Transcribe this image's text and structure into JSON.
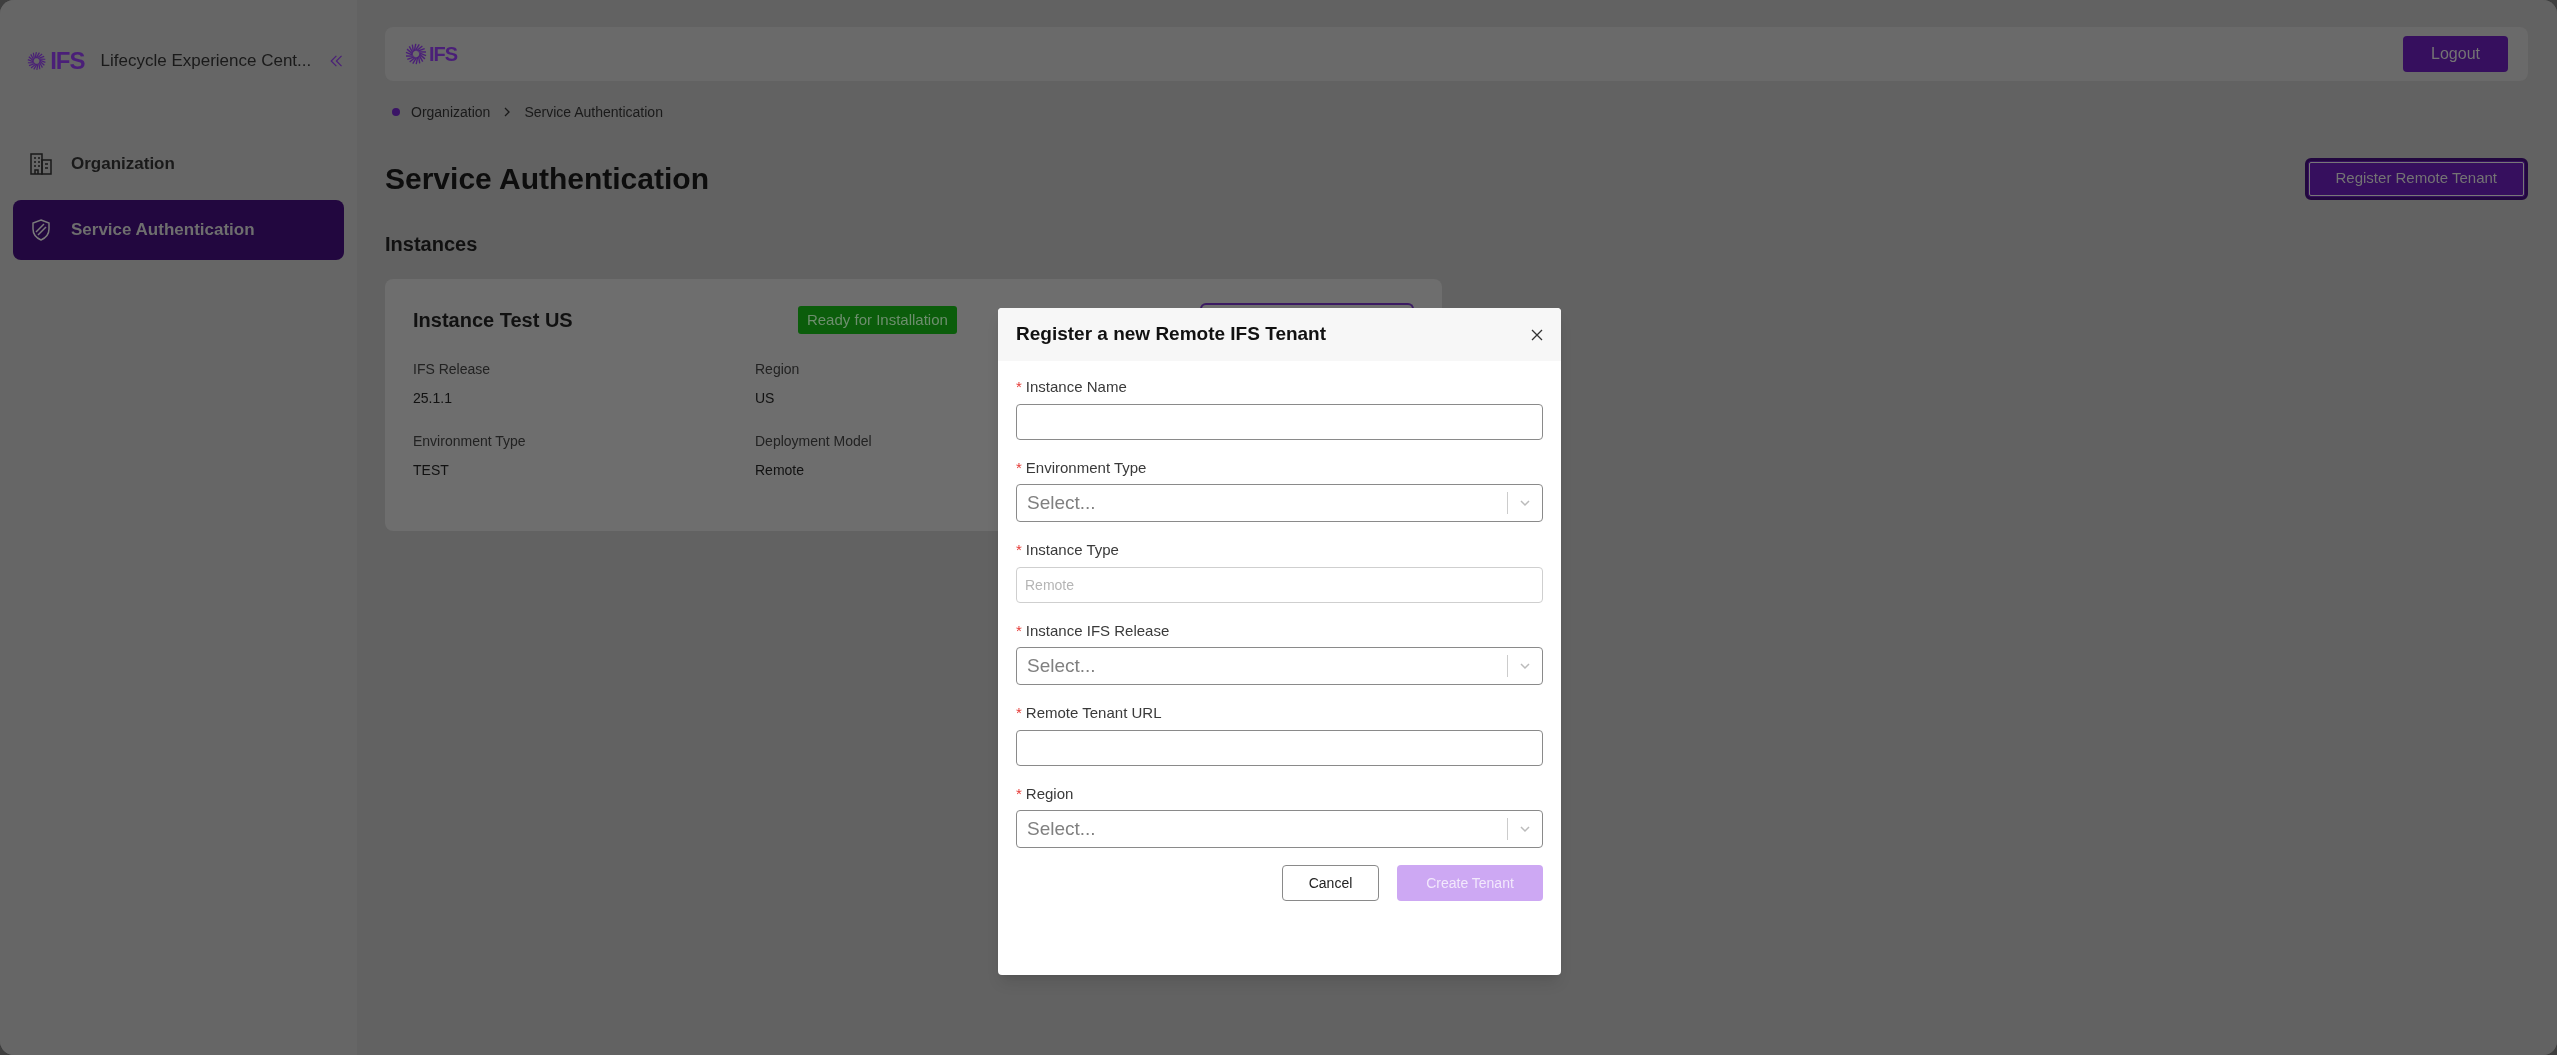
{
  "sidebar": {
    "logo_text": "IFS",
    "app_title": "Lifecycle Experience Cent...",
    "items": [
      {
        "kind": "building",
        "label": "Organization",
        "selected": false
      },
      {
        "kind": "shield",
        "label": "Service Authentication",
        "selected": true
      }
    ]
  },
  "top_bar": {
    "logo_text": "IFS",
    "logout": "Logout"
  },
  "breadcrumb": [
    "Organization",
    "Service Authentication"
  ],
  "page_title": "Service Authentication",
  "register_button": "Register Remote Tenant",
  "section_title": "Instances",
  "instance_card": {
    "name": "Instance Test US",
    "status": "Ready for Installation",
    "fields": [
      {
        "label": "IFS Release",
        "value": "25.1.1"
      },
      {
        "label": "Region",
        "value": "US"
      },
      {
        "label": "Environment Type",
        "value": "TEST"
      },
      {
        "label": "Deployment Model",
        "value": "Remote"
      }
    ]
  },
  "dialog": {
    "title": "Register a new Remote IFS Tenant",
    "fields": [
      {
        "kind": "text",
        "marker": "*",
        "label": "Instance Name",
        "disabled": false
      },
      {
        "kind": "select",
        "marker": "*",
        "label": "Environment Type",
        "placeholder": "Select..."
      },
      {
        "kind": "text",
        "marker": "*",
        "label": "Instance Type",
        "value": "Remote",
        "disabled": true
      },
      {
        "kind": "select",
        "marker": "*",
        "label": "Instance IFS Release",
        "placeholder": "Select..."
      },
      {
        "kind": "text",
        "marker": "*",
        "label": "Remote Tenant URL",
        "disabled": false
      },
      {
        "kind": "select",
        "marker": "*",
        "label": "Region",
        "placeholder": "Select..."
      }
    ],
    "buttons": [
      {
        "kind": "secondary",
        "label": "Cancel"
      },
      {
        "kind": "primary",
        "label": "Create Tenant",
        "disabled": true
      }
    ]
  }
}
